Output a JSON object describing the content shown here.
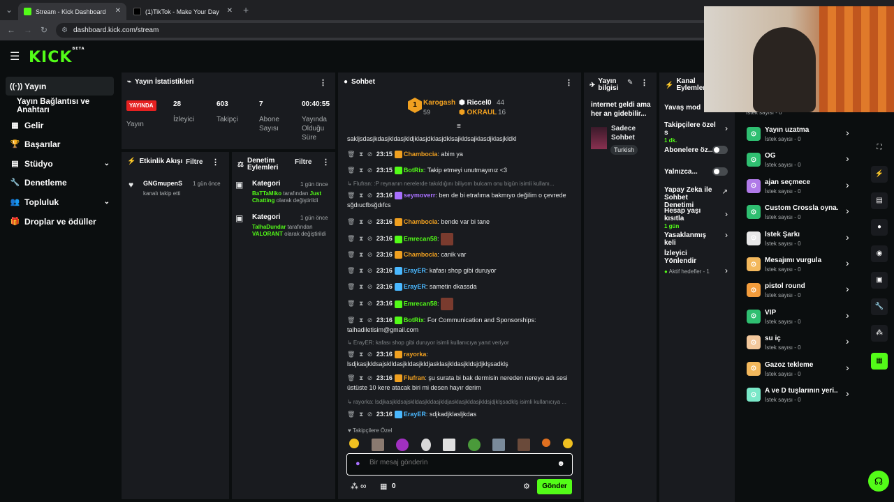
{
  "browser": {
    "tabs": [
      {
        "title": "Stream - Kick Dashboard",
        "active": true
      },
      {
        "title": "(1)TikTok - Make Your Day",
        "active": false
      }
    ],
    "url": "dashboard.kick.com/stream"
  },
  "brand": {
    "logo": "KICK",
    "beta": "BETA",
    "accent": "#53fc18"
  },
  "sidebar": {
    "items": [
      {
        "label": "Yayın",
        "icon": "broadcast-icon"
      },
      {
        "label": "Yayın Bağlantısı ve Anahtarı",
        "icon": ""
      },
      {
        "label": "Gelir",
        "icon": "revenue-icon"
      },
      {
        "label": "Başarılar",
        "icon": "trophy-icon"
      },
      {
        "label": "Stüdyo",
        "icon": "studio-icon"
      },
      {
        "label": "Denetleme",
        "icon": "wrench-icon"
      },
      {
        "label": "Topluluk",
        "icon": "community-icon"
      },
      {
        "label": "Droplar ve ödüller",
        "icon": "gift-icon"
      }
    ]
  },
  "stats": {
    "title": "Yayın İstatistikleri",
    "live_label": "YAYINDA",
    "live_caption": "Yayın",
    "viewers": "28",
    "viewers_label": "İzleyici",
    "followers": "603",
    "followers_label": "Takipçi",
    "subs": "7",
    "subs_label": "Abone Sayısı",
    "duration": "00:40:55",
    "duration_label": "Yayında Olduğu Süre"
  },
  "activity": {
    "title": "Etkinlik Akışı",
    "filter": "Filtre",
    "items": [
      {
        "user": "GNGmupenS",
        "time": "1 gün önce",
        "text": "kanalı takip etti"
      }
    ]
  },
  "moderation": {
    "title": "Denetim Eylemleri",
    "filter": "Filtre",
    "items": [
      {
        "title": "Kategori",
        "time": "1 gün önce",
        "user": "BaTTaMiko",
        "mid": " tarafından ",
        "cat": "Just Chatting",
        "end": " olarak değiştirildi"
      },
      {
        "title": "Kategori",
        "time": "1 gün önce",
        "user": "TalhaDundar",
        "mid": " tarafından ",
        "cat": "VALORANT",
        "end": " olarak değiştirildi"
      }
    ]
  },
  "chat": {
    "title": "Sohbet",
    "top": [
      {
        "name": "Karogash",
        "count": "59"
      },
      {
        "name": "Riccel0",
        "count": "44"
      },
      {
        "name": "OKRAUL",
        "count": "16"
      }
    ],
    "first_line": "sakljsdasjkdasjkldasjkldjklasjdklasjdklsajkldsajklasdjklasjkldkl",
    "messages": [
      {
        "time": "23:15",
        "user": "Chambocia",
        "color": "#f0a020",
        "text": ": abim ya"
      },
      {
        "time": "23:15",
        "user": "BotRix",
        "color": "#53fc18",
        "text": ": Takip etmeyi unutmayınız <3"
      },
      {
        "reply": "Flufran: :P reynanın nerelerde takıldığını biliyom bulcam onu bigün isimli kullanı..."
      },
      {
        "time": "23:16",
        "user": "seymoverr",
        "color": "#a970ff",
        "text": ": ben de bi etrafıma bakmıyo değilim o çevrede sğdıucfbsğdıfcs"
      },
      {
        "time": "23:16",
        "user": "Chambocia",
        "color": "#f0a020",
        "text": ": bende var bi tane"
      },
      {
        "time": "23:16",
        "user": "Emrecan58",
        "color": "#53fc18",
        "text": ":"
      },
      {
        "time": "23:16",
        "user": "Chambocia",
        "color": "#f0a020",
        "text": ": canik var"
      },
      {
        "time": "23:16",
        "user": "ErayER",
        "color": "#4ab8ff",
        "text": ": kafası shop gibi duruyor"
      },
      {
        "time": "23:16",
        "user": "ErayER",
        "color": "#4ab8ff",
        "text": ": sametin dkassda"
      },
      {
        "time": "23:16",
        "user": "Emrecan58",
        "color": "#53fc18",
        "text": ":"
      },
      {
        "time": "23:16",
        "user": "BotRix",
        "color": "#53fc18",
        "text": ": For Communication and Sponsorships: talhadiletisim@gmail.com"
      },
      {
        "reply": "ErayER: kafası shop gibi duruyor isimli kullanıcıya yanıt veriyor"
      },
      {
        "time": "23:16",
        "user": "rayorka",
        "color": "#f0a020",
        "text": ": lsdjkasjkldsajsklldasjkldasjkldjasklasjkldasjkldsjdjklşsadklş"
      },
      {
        "time": "23:16",
        "user": "Flufran",
        "color": "#f0a020",
        "text": ": şu surata bi bak dermisin nereden nereye adı sesi üstüste 10 kere atacak biri mi desen hayır derim"
      },
      {
        "reply": "rayorka: lsdjkasjkldsajsklldasjkldasjkldjasklasjkldasjkldsjdjklşsadklş isimli kullanıcıya ..."
      },
      {
        "time": "23:16",
        "user": "ErayER",
        "color": "#4ab8ff",
        "text": ": sdjkadjklasljkdas"
      }
    ],
    "followers_only": "Takipçilere Özel",
    "placeholder": "Bir mesaj gönderin",
    "infinity": "∞",
    "count": "0",
    "send": "Gönder"
  },
  "stream_info": {
    "title": "Yayın bilgisi",
    "stream_title": "internet geldi ama her an gidebilir...",
    "category": "Sadece Sohbet",
    "tag": "Turkish"
  },
  "channel_actions": {
    "title": "Kanal Eylemleri",
    "items": [
      {
        "label": "Yavaş mod",
        "sub": "",
        "control": "none"
      },
      {
        "label": "Takipçilere özel s",
        "sub": "1 dk.",
        "control": "arrow"
      },
      {
        "label": "Abonelere öz...",
        "sub": "",
        "control": "toggle"
      },
      {
        "label": "Yalnızca...",
        "sub": "",
        "control": "toggle"
      },
      {
        "label": "Yapay Zeka ile Sohbet Denetimi",
        "sub": "",
        "control": "ext"
      },
      {
        "label": "Hesap yaşı kısıtla",
        "sub": "1 gün",
        "control": "arrow"
      },
      {
        "label": "Yasaklanmış keli",
        "sub": "",
        "control": "arrow"
      },
      {
        "label": "İzleyici Yönlendir",
        "sub": "",
        "control": "none"
      },
      {
        "label": "Aktif hedefler - 1",
        "sub": "",
        "control": "arrow"
      }
    ]
  },
  "rewards": {
    "top_cut": "İstek sayısı - 0",
    "items": [
      {
        "title": "Yayın uzatma",
        "sub": "İstek sayısı - 0",
        "color": "#2fbf71"
      },
      {
        "title": "OG",
        "sub": "İstek sayısı - 0",
        "color": "#2fbf71"
      },
      {
        "title": "ajan seçmece",
        "sub": "İstek sayısı - 0",
        "color": "#b07ae8"
      },
      {
        "title": "Custom Crossla oyna...",
        "sub": "İstek sayısı - 0",
        "color": "#2fbf71"
      },
      {
        "title": "İstek Şarkı",
        "sub": "İstek sayısı - 0",
        "color": "#e8e8e8"
      },
      {
        "title": "Mesajımı vurgula",
        "sub": "İstek sayısı - 0",
        "color": "#f3b85c"
      },
      {
        "title": "pistol round",
        "sub": "İstek sayısı - 0",
        "color": "#f39c3c"
      },
      {
        "title": "VIP",
        "sub": "İstek sayısı - 0",
        "color": "#2fbf71"
      },
      {
        "title": "su iç",
        "sub": "İstek sayısı - 0",
        "color": "#f3c89c"
      },
      {
        "title": "Gazoz tekleme",
        "sub": "İstek sayısı - 0",
        "color": "#f3b85c"
      },
      {
        "title": "A ve D tuşlarının yeri...",
        "sub": "İstek sayısı - 0",
        "color": "#7ae8c8"
      }
    ]
  }
}
